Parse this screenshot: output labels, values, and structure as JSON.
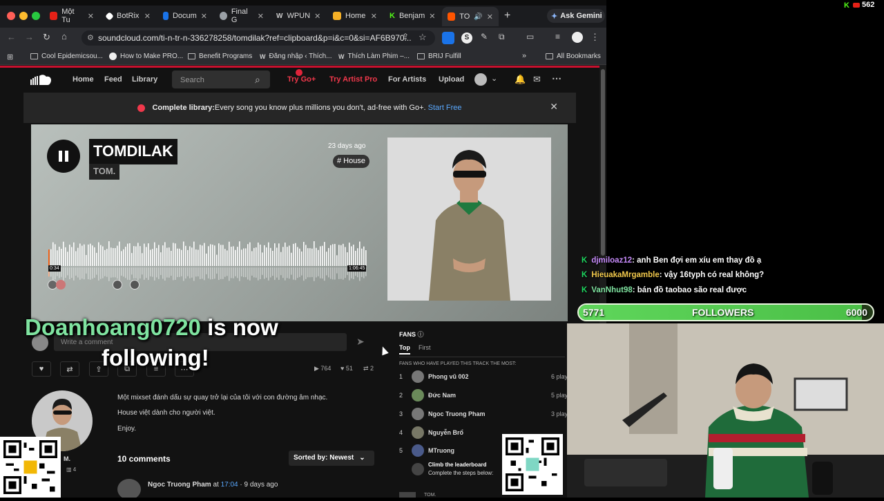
{
  "browser": {
    "tabs": [
      {
        "label": "Một Tu",
        "color": "#e62117"
      },
      {
        "label": "BotRix",
        "color": "#ffffff"
      },
      {
        "label": "Docum",
        "color": "#1a73e8"
      },
      {
        "label": "Final G",
        "color": "#9aa0a6"
      },
      {
        "label": "WPUN",
        "color": "#cccccc"
      },
      {
        "label": "Home",
        "color": "#f6b026"
      },
      {
        "label": "Benjam",
        "color": "#53fc18"
      },
      {
        "label": "TO",
        "color": "#ff5500"
      }
    ],
    "ask_gemini": "Ask Gemini",
    "url": "soundcloud.com/ti-n-tr-n-336278258/tomdilak?ref=clipboard&p=i&c=0&si=AF6B970...",
    "bookmarks": [
      "Cool Epidemicsou...",
      "How to Make PRO...",
      "Benefit Programs",
      "Đăng nhập ‹ Thích...",
      "Thích Làm Phim –...",
      "BRIJ Fulfill"
    ],
    "all_bookmarks": "All Bookmarks",
    "kick_count": "562"
  },
  "soundcloud": {
    "nav": {
      "home": "Home",
      "feed": "Feed",
      "library": "Library",
      "search_placeholder": "Search",
      "try_go": "Try Go+",
      "try_artist": "Try Artist Pro",
      "for_artists": "For Artists",
      "upload": "Upload"
    },
    "banner": {
      "bold": "Complete library:",
      "text": " Every song you know plus millions you don't, ad-free with Go+.",
      "link": "Start Free"
    },
    "track": {
      "title": "TOMDILAK",
      "artist": "TOM.",
      "ago": "23 days ago",
      "tag": "# House",
      "time_current": "0:34",
      "time_total": "1:06:45",
      "progress": 0.0085
    },
    "comment_placeholder": "Write a comment",
    "stats": {
      "plays": "764",
      "likes": "51",
      "reposts": "2"
    },
    "description": [
      "Một mixset đánh dấu sự quay trở lại của tôi với con đường âm nhạc.",
      "House việt dành cho người việt.",
      "Enjoy."
    ],
    "user_short": "M.",
    "user_tracks": "4",
    "comments_count": "10 comments",
    "sorted_by": "Sorted by: Newest",
    "first_comment": {
      "user": "Ngoc Truong Pham",
      "at": " at ",
      "time": "17:04",
      "ago": " · 9 days ago"
    },
    "fans": {
      "title": "FANS",
      "tab_top": "Top",
      "tab_first": "First",
      "subtitle": "FANS WHO HAVE PLAYED THIS TRACK THE MOST:",
      "rows": [
        {
          "rank": "1",
          "name": "Phong vũ 002",
          "plays": "6 plays"
        },
        {
          "rank": "2",
          "name": "Đức Nam",
          "plays": "5 plays"
        },
        {
          "rank": "3",
          "name": "Ngoc Truong Pham",
          "plays": "3 plays"
        },
        {
          "rank": "4",
          "name": "Nguyễn Brổ",
          "plays": ""
        },
        {
          "rank": "5",
          "name": "MTruong",
          "plays": ""
        }
      ],
      "leaderboard_title": "Climb the leaderboard",
      "leaderboard_text": "Complete the steps below:",
      "bottom_user": "TOM."
    }
  },
  "overlay": {
    "follow_user": "Doanhoang0720",
    "follow_text1": " is now",
    "follow_text2": "following!"
  },
  "chat": [
    {
      "user": "djmiloaz12",
      "color": "#c58af9",
      "msg": ": anh Ben đợi em xíu em thay đồ ạ"
    },
    {
      "user": "HieuakaMrgamble",
      "color": "#f2c94c",
      "msg": ": vậy 16typh có real không?"
    },
    {
      "user": "VanNhut98",
      "color": "#7fe3a0",
      "msg": ": bán đồ taobao são real được"
    }
  ],
  "followers_goal": {
    "current": "5771",
    "label": "FOLLOWERS",
    "target": "6000",
    "fraction": 0.9618
  }
}
